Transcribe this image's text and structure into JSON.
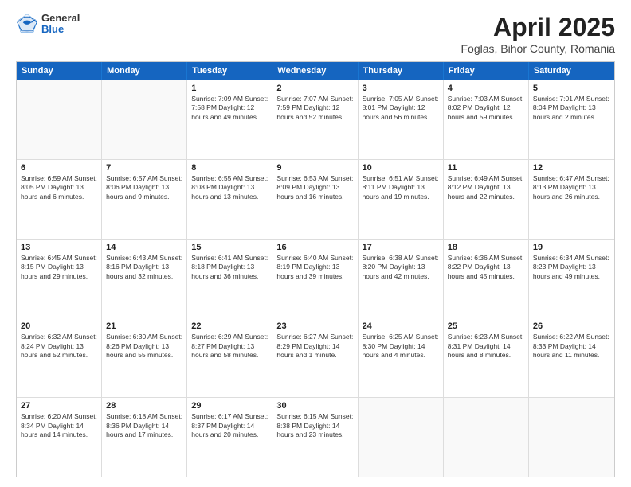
{
  "header": {
    "logo": {
      "general": "General",
      "blue": "Blue"
    },
    "title": "April 2025",
    "subtitle": "Foglas, Bihor County, Romania"
  },
  "days_of_week": [
    "Sunday",
    "Monday",
    "Tuesday",
    "Wednesday",
    "Thursday",
    "Friday",
    "Saturday"
  ],
  "weeks": [
    [
      {
        "day": "",
        "info": ""
      },
      {
        "day": "",
        "info": ""
      },
      {
        "day": "1",
        "info": "Sunrise: 7:09 AM\nSunset: 7:58 PM\nDaylight: 12 hours and 49 minutes."
      },
      {
        "day": "2",
        "info": "Sunrise: 7:07 AM\nSunset: 7:59 PM\nDaylight: 12 hours and 52 minutes."
      },
      {
        "day": "3",
        "info": "Sunrise: 7:05 AM\nSunset: 8:01 PM\nDaylight: 12 hours and 56 minutes."
      },
      {
        "day": "4",
        "info": "Sunrise: 7:03 AM\nSunset: 8:02 PM\nDaylight: 12 hours and 59 minutes."
      },
      {
        "day": "5",
        "info": "Sunrise: 7:01 AM\nSunset: 8:04 PM\nDaylight: 13 hours and 2 minutes."
      }
    ],
    [
      {
        "day": "6",
        "info": "Sunrise: 6:59 AM\nSunset: 8:05 PM\nDaylight: 13 hours and 6 minutes."
      },
      {
        "day": "7",
        "info": "Sunrise: 6:57 AM\nSunset: 8:06 PM\nDaylight: 13 hours and 9 minutes."
      },
      {
        "day": "8",
        "info": "Sunrise: 6:55 AM\nSunset: 8:08 PM\nDaylight: 13 hours and 13 minutes."
      },
      {
        "day": "9",
        "info": "Sunrise: 6:53 AM\nSunset: 8:09 PM\nDaylight: 13 hours and 16 minutes."
      },
      {
        "day": "10",
        "info": "Sunrise: 6:51 AM\nSunset: 8:11 PM\nDaylight: 13 hours and 19 minutes."
      },
      {
        "day": "11",
        "info": "Sunrise: 6:49 AM\nSunset: 8:12 PM\nDaylight: 13 hours and 22 minutes."
      },
      {
        "day": "12",
        "info": "Sunrise: 6:47 AM\nSunset: 8:13 PM\nDaylight: 13 hours and 26 minutes."
      }
    ],
    [
      {
        "day": "13",
        "info": "Sunrise: 6:45 AM\nSunset: 8:15 PM\nDaylight: 13 hours and 29 minutes."
      },
      {
        "day": "14",
        "info": "Sunrise: 6:43 AM\nSunset: 8:16 PM\nDaylight: 13 hours and 32 minutes."
      },
      {
        "day": "15",
        "info": "Sunrise: 6:41 AM\nSunset: 8:18 PM\nDaylight: 13 hours and 36 minutes."
      },
      {
        "day": "16",
        "info": "Sunrise: 6:40 AM\nSunset: 8:19 PM\nDaylight: 13 hours and 39 minutes."
      },
      {
        "day": "17",
        "info": "Sunrise: 6:38 AM\nSunset: 8:20 PM\nDaylight: 13 hours and 42 minutes."
      },
      {
        "day": "18",
        "info": "Sunrise: 6:36 AM\nSunset: 8:22 PM\nDaylight: 13 hours and 45 minutes."
      },
      {
        "day": "19",
        "info": "Sunrise: 6:34 AM\nSunset: 8:23 PM\nDaylight: 13 hours and 49 minutes."
      }
    ],
    [
      {
        "day": "20",
        "info": "Sunrise: 6:32 AM\nSunset: 8:24 PM\nDaylight: 13 hours and 52 minutes."
      },
      {
        "day": "21",
        "info": "Sunrise: 6:30 AM\nSunset: 8:26 PM\nDaylight: 13 hours and 55 minutes."
      },
      {
        "day": "22",
        "info": "Sunrise: 6:29 AM\nSunset: 8:27 PM\nDaylight: 13 hours and 58 minutes."
      },
      {
        "day": "23",
        "info": "Sunrise: 6:27 AM\nSunset: 8:29 PM\nDaylight: 14 hours and 1 minute."
      },
      {
        "day": "24",
        "info": "Sunrise: 6:25 AM\nSunset: 8:30 PM\nDaylight: 14 hours and 4 minutes."
      },
      {
        "day": "25",
        "info": "Sunrise: 6:23 AM\nSunset: 8:31 PM\nDaylight: 14 hours and 8 minutes."
      },
      {
        "day": "26",
        "info": "Sunrise: 6:22 AM\nSunset: 8:33 PM\nDaylight: 14 hours and 11 minutes."
      }
    ],
    [
      {
        "day": "27",
        "info": "Sunrise: 6:20 AM\nSunset: 8:34 PM\nDaylight: 14 hours and 14 minutes."
      },
      {
        "day": "28",
        "info": "Sunrise: 6:18 AM\nSunset: 8:36 PM\nDaylight: 14 hours and 17 minutes."
      },
      {
        "day": "29",
        "info": "Sunrise: 6:17 AM\nSunset: 8:37 PM\nDaylight: 14 hours and 20 minutes."
      },
      {
        "day": "30",
        "info": "Sunrise: 6:15 AM\nSunset: 8:38 PM\nDaylight: 14 hours and 23 minutes."
      },
      {
        "day": "",
        "info": ""
      },
      {
        "day": "",
        "info": ""
      },
      {
        "day": "",
        "info": ""
      }
    ]
  ]
}
